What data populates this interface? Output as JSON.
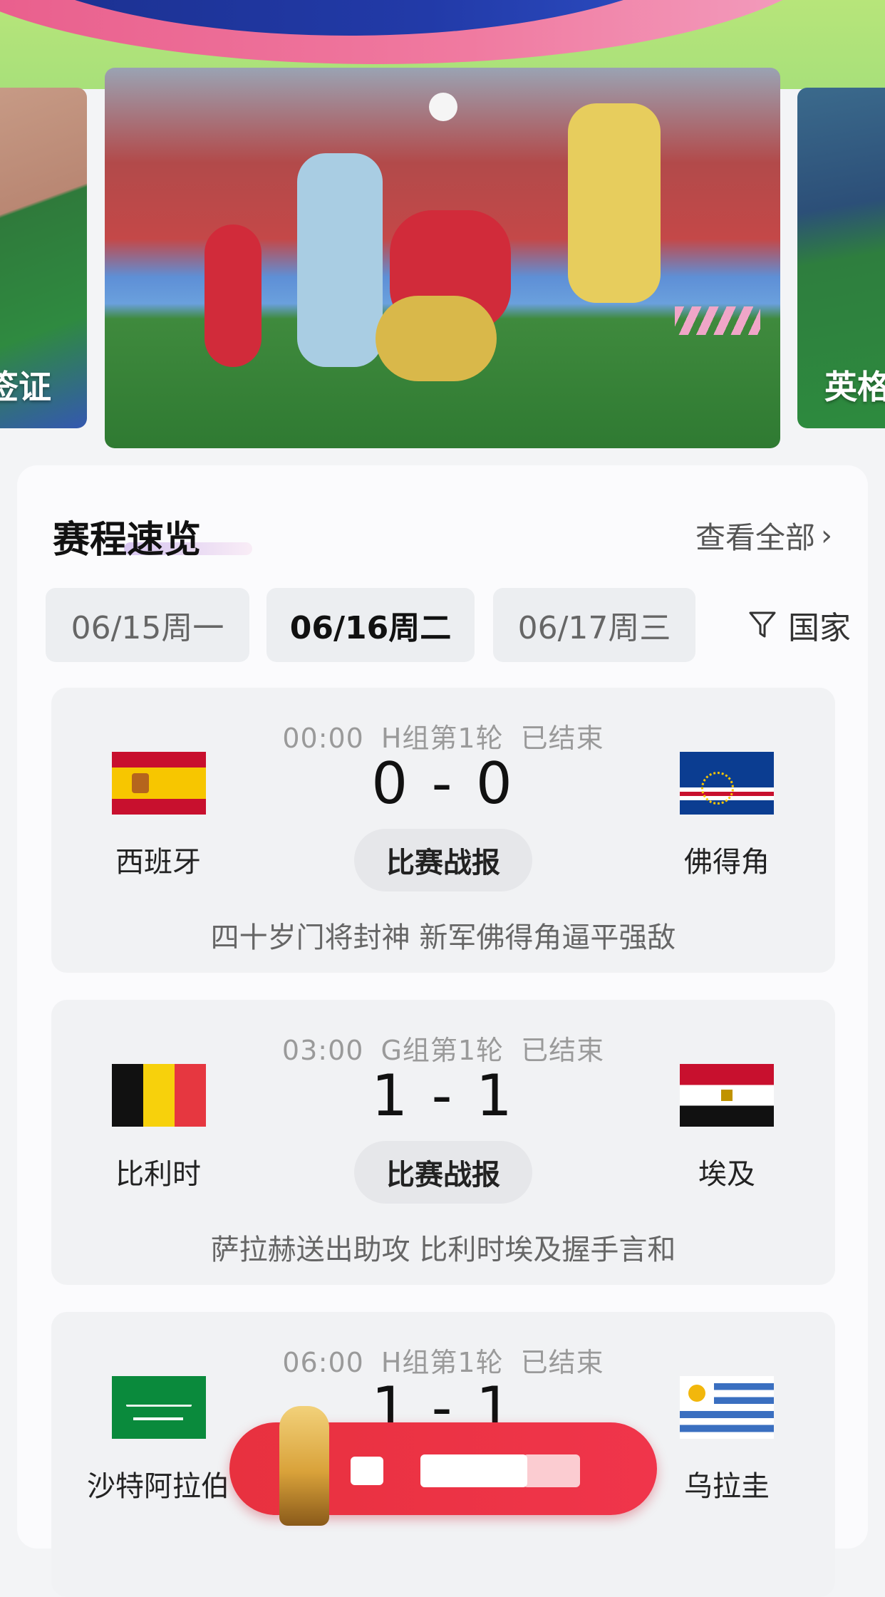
{
  "carousel": {
    "left_caption": "签证",
    "right_caption": "英格"
  },
  "schedule": {
    "title": "赛程速览",
    "view_all": "查看全部",
    "dates": [
      "06/15周一",
      "06/16周二",
      "06/17周三"
    ],
    "active_date_index": 1,
    "filter_label": "国家"
  },
  "matches": [
    {
      "time": "00:00",
      "round": "H组第1轮",
      "status": "已结束",
      "home": "西班牙",
      "away": "佛得角",
      "score": "0 - 0",
      "report": "比赛战报",
      "headline": "四十岁门将封神 新军佛得角逼平强敌"
    },
    {
      "time": "03:00",
      "round": "G组第1轮",
      "status": "已结束",
      "home": "比利时",
      "away": "埃及",
      "score": "1 - 1",
      "report": "比赛战报",
      "headline": "萨拉赫送出助攻 比利时埃及握手言和"
    },
    {
      "time": "06:00",
      "round": "H组第1轮",
      "status": "已结束",
      "home": "沙特阿拉伯",
      "away": "乌拉圭",
      "score": "1 - 1"
    }
  ],
  "colors": {
    "accent_red": "#e8313f",
    "banner_green": "#b7e57a"
  }
}
